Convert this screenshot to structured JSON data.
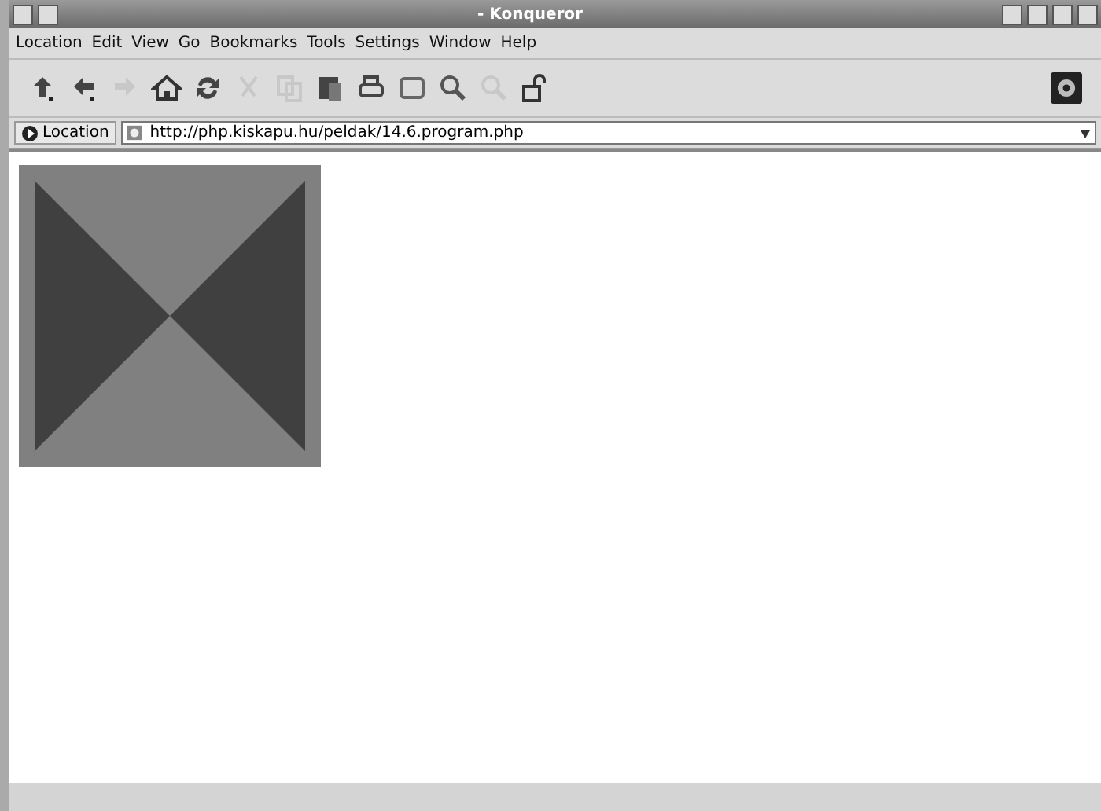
{
  "window": {
    "title": "- Konqueror"
  },
  "menu": [
    "Location",
    "Edit",
    "View",
    "Go",
    "Bookmarks",
    "Tools",
    "Settings",
    "Window",
    "Help"
  ],
  "toolbar": [
    {
      "kind": "up",
      "disabled": false
    },
    {
      "kind": "back",
      "disabled": false
    },
    {
      "kind": "forward",
      "disabled": true
    },
    {
      "kind": "home",
      "disabled": false
    },
    {
      "kind": "reload",
      "disabled": false
    },
    {
      "kind": "cut",
      "disabled": true
    },
    {
      "kind": "copy",
      "disabled": true
    },
    {
      "kind": "paste",
      "disabled": false
    },
    {
      "kind": "print",
      "disabled": false
    },
    {
      "kind": "window",
      "disabled": false
    },
    {
      "kind": "zoom-in",
      "disabled": false
    },
    {
      "kind": "zoom-out",
      "disabled": true
    },
    {
      "kind": "security",
      "disabled": false
    }
  ],
  "location": {
    "label": "Location",
    "value": "http://php.kiskapu.hu/peldak/14.6.program.php"
  }
}
